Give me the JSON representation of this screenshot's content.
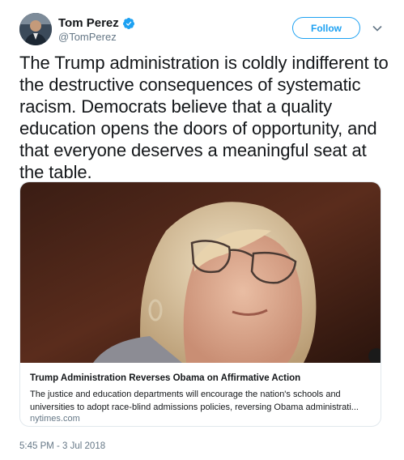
{
  "author": {
    "name": "Tom Perez",
    "handle": "@TomPerez",
    "verified": true
  },
  "follow_label": "Follow",
  "tweet_text": "The Trump administration is coldly indifferent to the destructive consequences of systematic racism. Democrats believe that a quality education opens the doors of opportunity, and that everyone deserves a meaningful seat at the table.",
  "card": {
    "title": "Trump Administration Reverses Obama on Affirmative Action",
    "description": "The justice and education departments will encourage the nation's schools and universities to adopt race-blind admissions policies, reversing Obama administrati...",
    "domain": "nytimes.com"
  },
  "timestamp": "5:45 PM - 3 Jul 2018",
  "colors": {
    "accent": "#1da1f2",
    "text": "#14171a",
    "muted": "#657786",
    "border": "#e1e8ed"
  },
  "icons": [
    "verified-badge-icon",
    "chevron-down-icon"
  ]
}
